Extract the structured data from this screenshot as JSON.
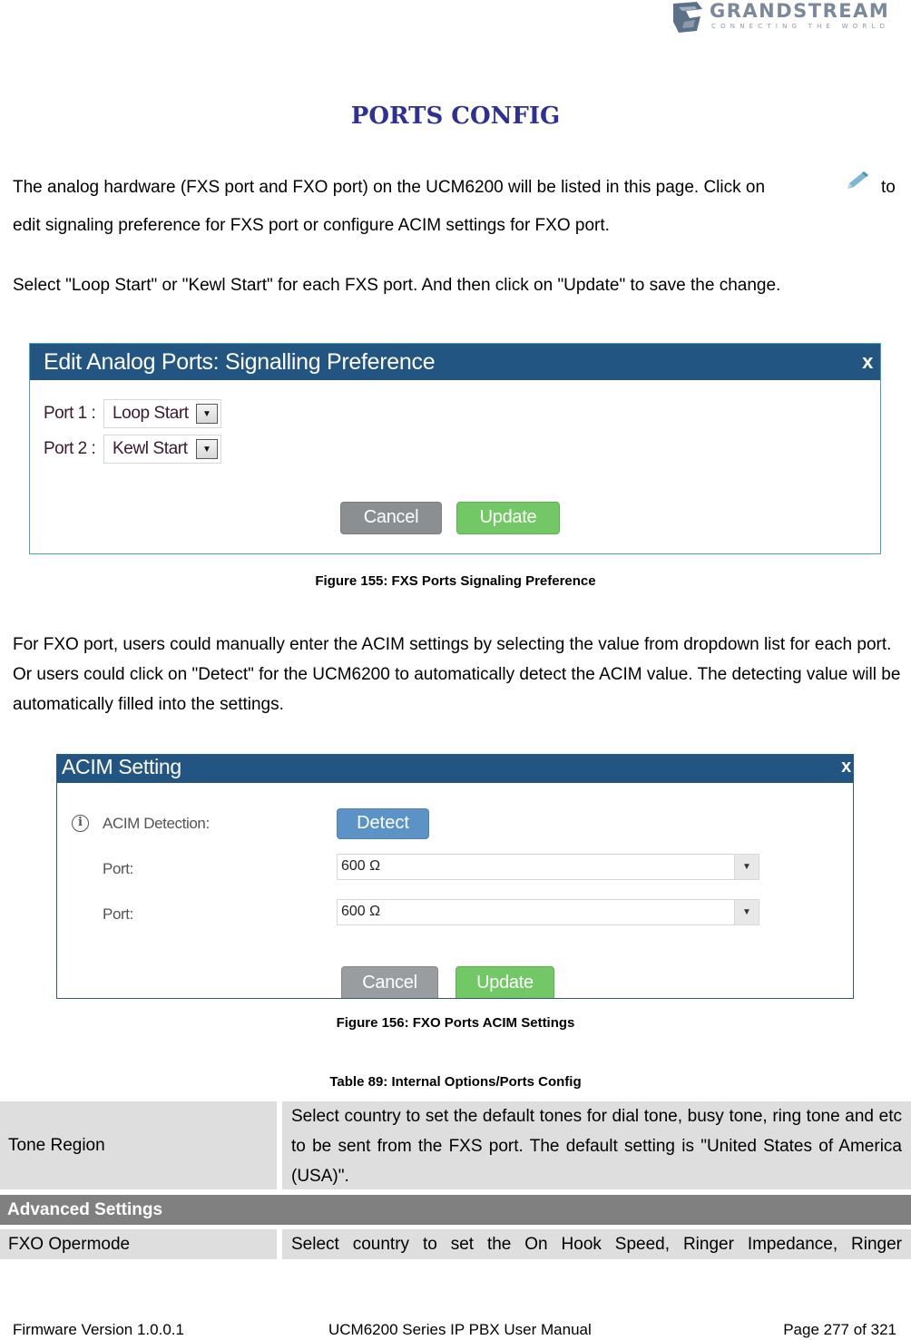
{
  "header": {
    "logo": {
      "name": "GRANDSTREAM",
      "tagline": "CONNECTING THE WORLD"
    }
  },
  "page_title": "PORTS CONFIG",
  "intro": {
    "line1": "The analog hardware (FXS port and FXO port) on the UCM6200 will be listed in this page. Click on",
    "line1_tail": "to",
    "line2": "edit signaling preference for FXS port or configure ACIM settings for FXO port.",
    "edit_icon": "pencil-icon"
  },
  "fxs_instruction": "Select \"Loop Start\" or \"Kewl Start\" for each FXS port. And then click on \"Update\" to save the change.",
  "figure155": {
    "dialog_title": "Edit Analog Ports: Signalling Preference",
    "close_label": "x",
    "ports": [
      {
        "label": "Port 1 :",
        "value": "Loop Start"
      },
      {
        "label": "Port 2 :",
        "value": "Kewl Start"
      }
    ],
    "cancel_label": "Cancel",
    "update_label": "Update",
    "caption": "Figure 155: FXS Ports Signaling Preference"
  },
  "fxo_paragraph": "For FXO port, users could manually enter the ACIM settings by selecting the value from dropdown list for each port. Or users could click on \"Detect\" for the UCM6200 to automatically detect the ACIM value. The detecting value will be automatically filled into the settings.",
  "figure156": {
    "dialog_title": "ACIM Setting",
    "close_label": "x",
    "detection_label": "ACIM Detection:",
    "detect_label": "Detect",
    "ports": [
      {
        "label": "Port:",
        "value": "600 Ω"
      },
      {
        "label": "Port:",
        "value": "600 Ω"
      }
    ],
    "cancel_label": "Cancel",
    "update_label": "Update",
    "caption": "Figure 156: FXO Ports ACIM Settings"
  },
  "table": {
    "caption": "Table 89: Internal Options/Ports Config",
    "rows": [
      {
        "key": "Tone Region",
        "desc": "Select country to set the default tones for dial tone, busy tone, ring tone and etc to be sent from the FXS port. The default setting is \"United States of America (USA)\"."
      }
    ],
    "section": "Advanced Settings",
    "rows2": [
      {
        "key": "FXO Opermode",
        "desc": "Select country to set the On Hook Speed, Ringer Impedance, Ringer"
      }
    ]
  },
  "footer": {
    "firmware": "Firmware Version 1.0.0.1",
    "manual": "UCM6200 Series IP PBX User Manual",
    "page": "Page 277 of 321"
  }
}
